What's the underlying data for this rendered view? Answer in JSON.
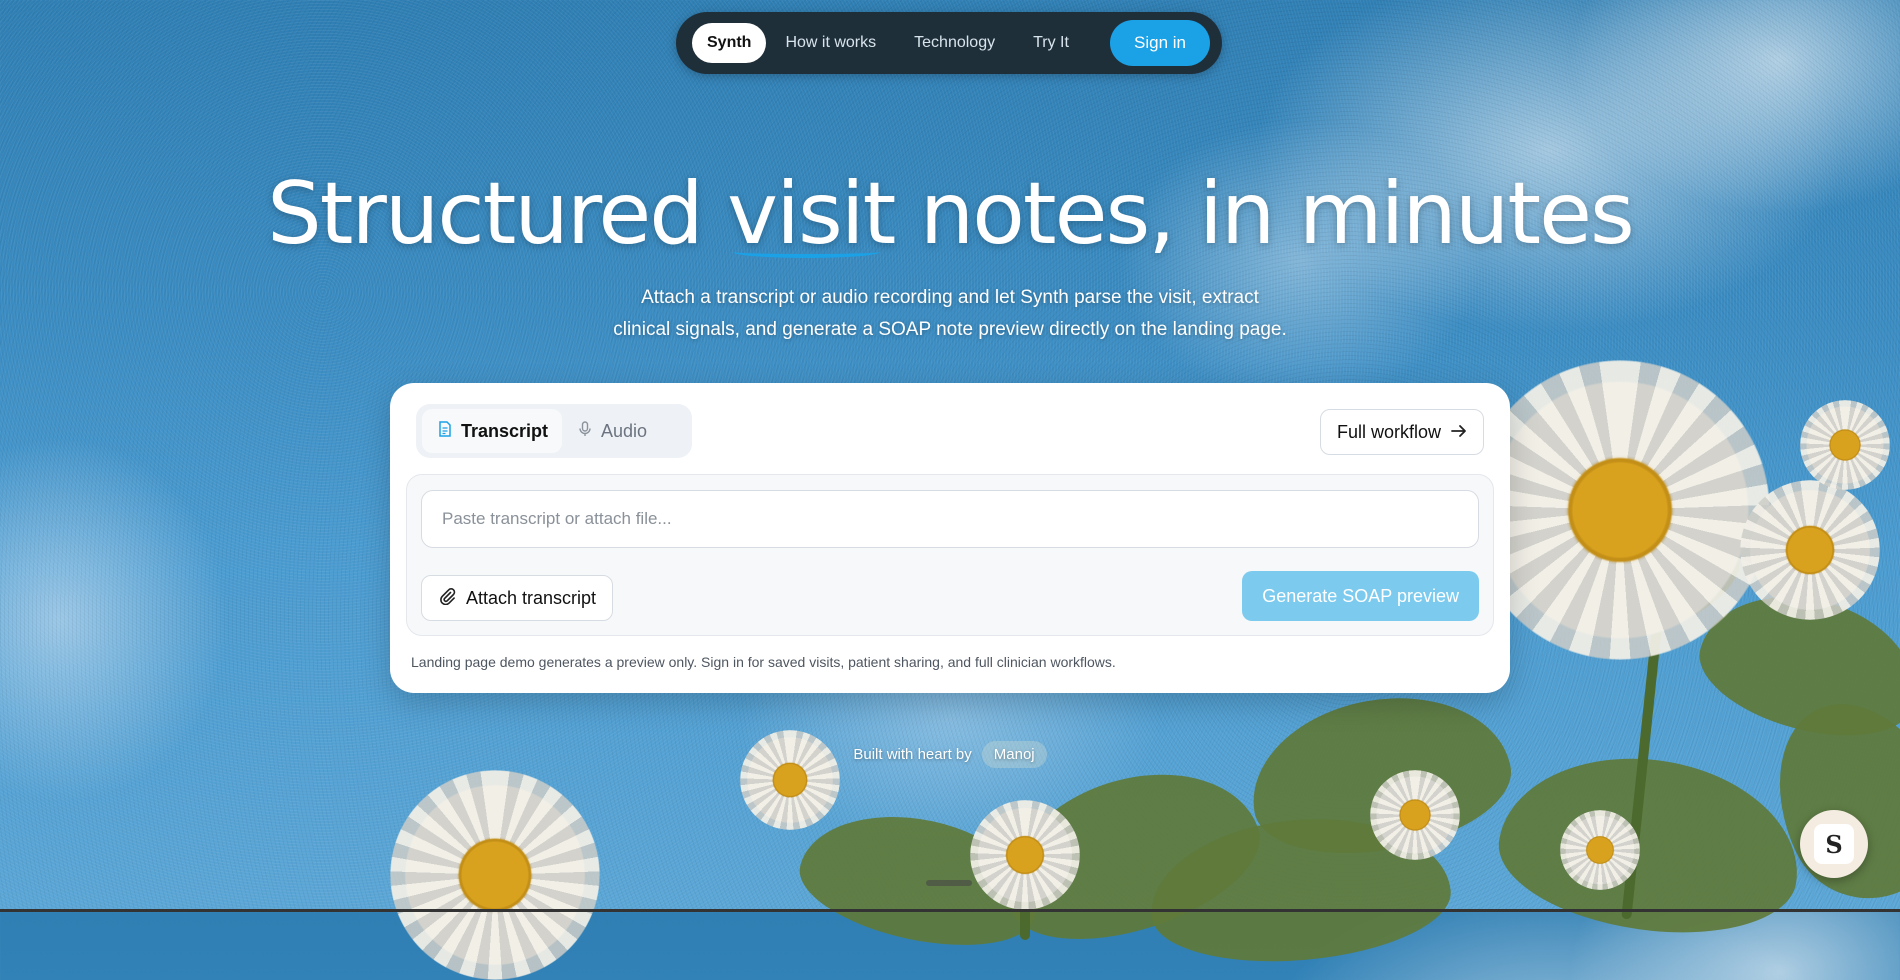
{
  "nav": {
    "brand": "Synth",
    "links": [
      "How it works",
      "Technology",
      "Try It"
    ],
    "signin": "Sign in"
  },
  "hero": {
    "title_part1": "Structured",
    "title_highlight": "visit",
    "title_part2": "notes, in minutes",
    "subtitle_line1": "Attach a transcript or audio recording and let Synth parse the visit, extract",
    "subtitle_line2": "clinical signals, and generate a SOAP note preview directly on the landing page."
  },
  "card": {
    "tabs": [
      {
        "label": "Transcript",
        "icon": "document-icon",
        "active": true
      },
      {
        "label": "Audio",
        "icon": "microphone-icon",
        "active": false
      }
    ],
    "full_workflow": "Full workflow",
    "input_placeholder": "Paste transcript or attach file...",
    "attach_label": "Attach transcript",
    "generate_label": "Generate SOAP preview",
    "note": "Landing page demo generates a preview only. Sign in for saved visits, patient sharing, and full clinician workflows."
  },
  "credit": {
    "text": "Built with heart by",
    "name": "Manoj"
  },
  "badge": {
    "letter": "S"
  },
  "colors": {
    "accent": "#1ba1e6",
    "nav_bg": "#1f2f3a",
    "generate_bg": "#7ccbef"
  }
}
